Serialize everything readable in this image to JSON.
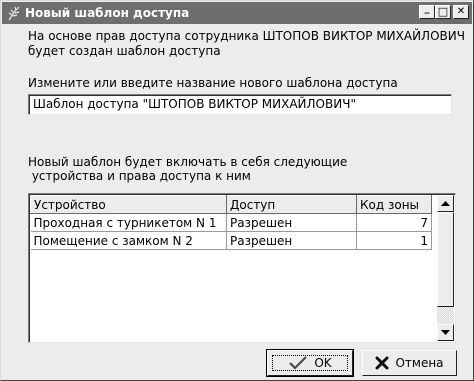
{
  "window": {
    "title": "Новый шаблон доступа",
    "minimize_glyph": "_",
    "maximize_glyph": "□",
    "close_glyph": "✕"
  },
  "intro": {
    "line1": "На основе прав доступа сотрудника ШТОПОВ ВИКТОР МИХАЙЛОВИЧ",
    "line2": "будет создан шаблон доступа"
  },
  "name_field": {
    "label": "Измените или введите название нового шаблона доступа",
    "value": "Шаблон доступа \"ШТОПОВ ВИКТОР МИХАЙЛОВИЧ\""
  },
  "devices": {
    "caption_line1": "Новый шаблон будет включать в себя следующие",
    "caption_line2": " устройства и права доступа к ним",
    "columns": [
      "Устройство",
      "Доступ",
      "Код зоны"
    ],
    "rows": [
      [
        "Проходная с турникетом N 1",
        "Разрешен",
        "7"
      ],
      [
        "Помещение с замком N 2",
        "Разрешен",
        "1"
      ]
    ]
  },
  "buttons": {
    "ok_label": "OK",
    "cancel_label": "Отмена"
  },
  "colors": {
    "titlebar": "#6e6e6e",
    "window_bg": "#ececec",
    "ok_check": "#4a4a4a",
    "cancel_x": "#111111"
  },
  "icons": {
    "title": "feather-icon",
    "ok": "checkmark-icon",
    "cancel": "x-icon"
  }
}
